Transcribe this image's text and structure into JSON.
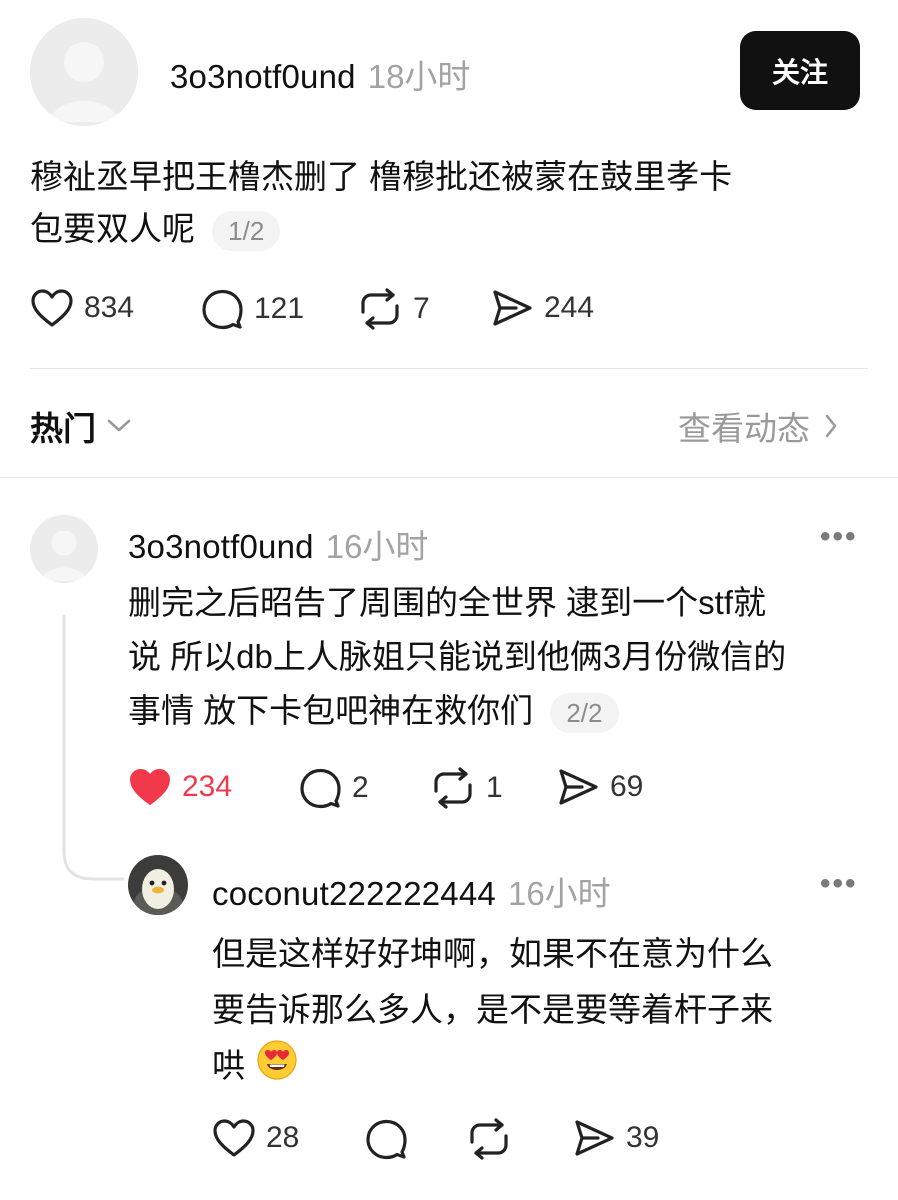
{
  "post": {
    "username": "3o3notf0und",
    "time": "18小时",
    "follow_label": "关注",
    "text_line1": "穆祉丞早把王橹杰删了 橹穆批还被蒙在鼓里孝卡",
    "text_line2": "包要双人呢",
    "pager": "1/2",
    "actions": {
      "likes": "834",
      "comments": "121",
      "reposts": "7",
      "shares": "244"
    }
  },
  "filter": {
    "sort_label": "热门",
    "view_activity_label": "查看动态"
  },
  "reply1": {
    "username": "3o3notf0und",
    "time": "16小时",
    "text_line1": "删完之后昭告了周围的全世界 逮到一个stf就",
    "text_line2": "说 所以db上人脉姐只能说到他俩3月份微信的",
    "text_line3": "事情 放下卡包吧神在救你们",
    "pager": "2/2",
    "actions": {
      "likes": "234",
      "comments": "2",
      "reposts": "1",
      "shares": "69"
    },
    "liked_color": "#f2384b"
  },
  "reply2": {
    "username": "coconut222222444",
    "time": "16小时",
    "text_line1": "但是这样好好坤啊，如果不在意为什么",
    "text_line2": "要告诉那么多人，是不是要等着杆子来",
    "text_line3": "哄",
    "emoji": "😍",
    "actions": {
      "likes": "28",
      "comments": "",
      "reposts": "",
      "shares": "39"
    }
  },
  "icons": [
    "heart-icon",
    "comment-icon",
    "repost-icon",
    "share-icon",
    "chevron-down-icon",
    "chevron-right-icon",
    "more-icon"
  ]
}
